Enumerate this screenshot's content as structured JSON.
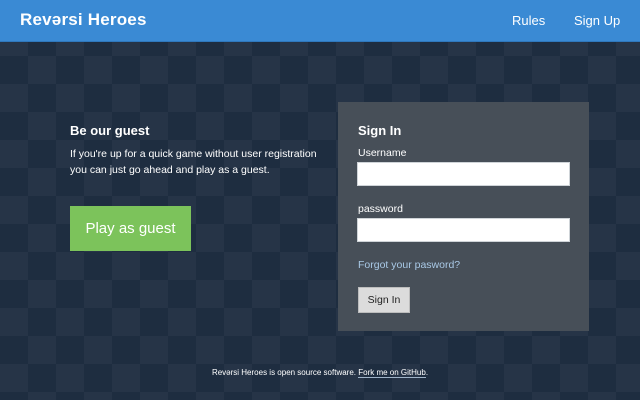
{
  "nav": {
    "brand": "Revərsi Heroes",
    "links": [
      "Rules",
      "Sign Up"
    ]
  },
  "guest": {
    "title": "Be our guest",
    "description": "If you're up for a quick game without user registration you can just go ahead and play as a guest.",
    "button_label": "Play as guest"
  },
  "signin": {
    "title": "Sign In",
    "username_label": "Username",
    "username_value": "",
    "password_label": "password",
    "password_value": "",
    "forgot_label": "Forgot your pasword?",
    "button_label": "Sign In"
  },
  "footer": {
    "text_before": "Revərsi Heroes is open source software.",
    "link_label": "Fork me on GitHub",
    "text_after": "."
  },
  "colors": {
    "navbar": "#3a8ad4",
    "background": "#1e2d40",
    "guest_button": "#7cc35b",
    "signin_panel": "#474f58",
    "link": "#a9c9e6"
  }
}
